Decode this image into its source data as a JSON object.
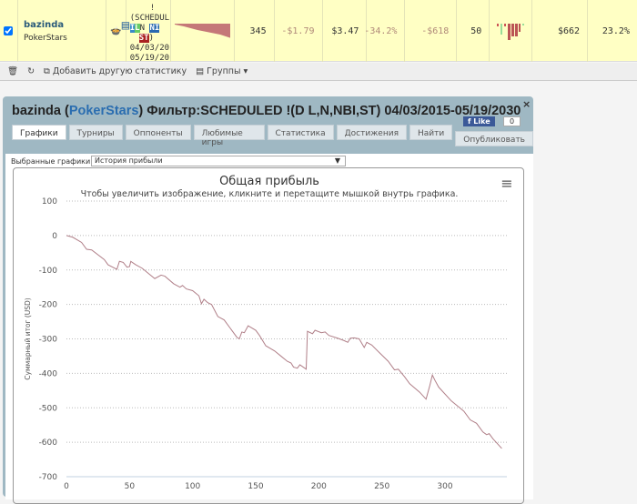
{
  "row": {
    "player": "bazinda",
    "site": "PokerStars",
    "filter_lines": [
      "!",
      "(SCHEDUL"
    ],
    "badges": [
      "I",
      "L",
      "N",
      "NI",
      "ST"
    ],
    "filter_tail": ")",
    "dates": [
      "04/03/20",
      "05/19/20"
    ],
    "games": "345",
    "avg_profit": "-$1.79",
    "avg_stake": "$3.47",
    "roi": "-34.2%",
    "total_profit": "-$618",
    "entries": "50",
    "total_stake": "$662",
    "itm": "23.2%"
  },
  "toolbar": {
    "add_stat": "Добавить другую статистику",
    "groups": "Группы"
  },
  "panel": {
    "player": "bazinda",
    "site": "PokerStars",
    "filter": "Фильтр:SCHEDULED !(D L,N,NBI,ST) 04/03/2015-05/19/2030",
    "like": "Like",
    "like_count": "0",
    "close": "×",
    "tabs": [
      "Графики",
      "Турниры",
      "Оппоненты",
      "Любимые игры",
      "Статистика",
      "Достижения",
      "Найти"
    ],
    "publish": "Опубликовать",
    "select_label": "Выбранные графики:",
    "select_value": "История прибыли"
  },
  "chart_data": {
    "type": "line",
    "title": "Общая прибыль",
    "subtitle": "Чтобы увеличить изображение, кликните и перетащите мышкой внутрь графика.",
    "ylabel": "Суммарный итог (USD)",
    "xlabel": "",
    "xlim": [
      0,
      350
    ],
    "ylim": [
      -700,
      100
    ],
    "xticks": [
      0,
      50,
      100,
      150,
      200,
      250,
      300
    ],
    "yticks": [
      100,
      0,
      -100,
      -200,
      -300,
      -400,
      -500,
      -600,
      -700
    ],
    "grid": true,
    "color": "#b07f88",
    "points": [
      [
        0,
        0
      ],
      [
        5,
        -5
      ],
      [
        12,
        -20
      ],
      [
        16,
        -40
      ],
      [
        20,
        -42
      ],
      [
        30,
        -70
      ],
      [
        33,
        -85
      ],
      [
        40,
        -98
      ],
      [
        42,
        -75
      ],
      [
        45,
        -78
      ],
      [
        48,
        -92
      ],
      [
        50,
        -90
      ],
      [
        51,
        -75
      ],
      [
        55,
        -85
      ],
      [
        60,
        -95
      ],
      [
        70,
        -125
      ],
      [
        75,
        -115
      ],
      [
        78,
        -118
      ],
      [
        85,
        -140
      ],
      [
        90,
        -150
      ],
      [
        92,
        -145
      ],
      [
        95,
        -155
      ],
      [
        100,
        -160
      ],
      [
        105,
        -175
      ],
      [
        107,
        -198
      ],
      [
        109,
        -185
      ],
      [
        112,
        -195
      ],
      [
        115,
        -200
      ],
      [
        120,
        -235
      ],
      [
        125,
        -245
      ],
      [
        130,
        -270
      ],
      [
        135,
        -295
      ],
      [
        137,
        -300
      ],
      [
        139,
        -280
      ],
      [
        141,
        -282
      ],
      [
        144,
        -262
      ],
      [
        150,
        -275
      ],
      [
        153,
        -290
      ],
      [
        158,
        -320
      ],
      [
        165,
        -335
      ],
      [
        170,
        -350
      ],
      [
        175,
        -365
      ],
      [
        178,
        -370
      ],
      [
        180,
        -382
      ],
      [
        183,
        -385
      ],
      [
        185,
        -375
      ],
      [
        190,
        -388
      ],
      [
        191,
        -278
      ],
      [
        195,
        -285
      ],
      [
        197,
        -275
      ],
      [
        202,
        -282
      ],
      [
        205,
        -280
      ],
      [
        208,
        -290
      ],
      [
        215,
        -298
      ],
      [
        220,
        -305
      ],
      [
        223,
        -310
      ],
      [
        225,
        -298
      ],
      [
        228,
        -297
      ],
      [
        232,
        -300
      ],
      [
        236,
        -325
      ],
      [
        238,
        -310
      ],
      [
        242,
        -318
      ],
      [
        248,
        -340
      ],
      [
        255,
        -365
      ],
      [
        260,
        -390
      ],
      [
        263,
        -388
      ],
      [
        268,
        -410
      ],
      [
        272,
        -430
      ],
      [
        280,
        -455
      ],
      [
        285,
        -475
      ],
      [
        288,
        -435
      ],
      [
        290,
        -405
      ],
      [
        292,
        -420
      ],
      [
        295,
        -440
      ],
      [
        305,
        -480
      ],
      [
        315,
        -510
      ],
      [
        320,
        -535
      ],
      [
        325,
        -545
      ],
      [
        330,
        -570
      ],
      [
        333,
        -578
      ],
      [
        335,
        -575
      ],
      [
        338,
        -590
      ],
      [
        345,
        -618
      ]
    ]
  }
}
